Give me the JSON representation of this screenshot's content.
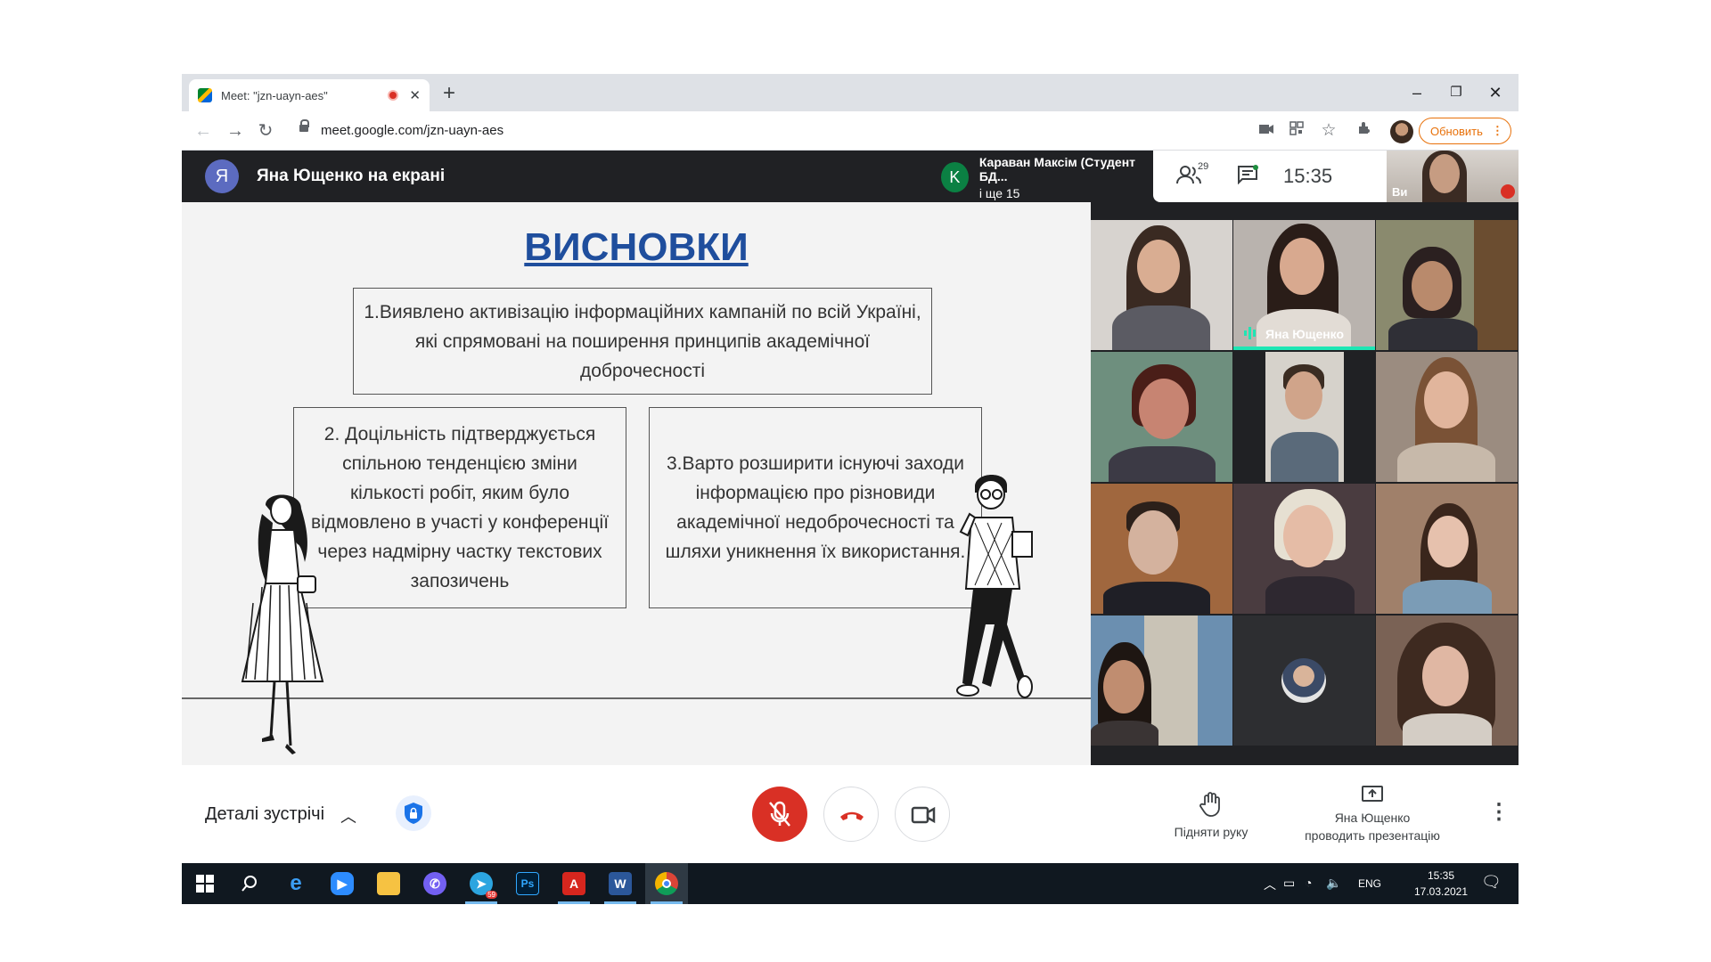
{
  "browser": {
    "tab_title": "Meet: \"jzn-uayn-aes\"",
    "tab_close": "✕",
    "new_tab": "+",
    "url": "meet.google.com/jzn-uayn-aes",
    "update_label": "Обновить",
    "minimize": "–",
    "restore": "❐",
    "close": "✕"
  },
  "meet": {
    "presenter_initial": "Я",
    "presenter_label": "Яна Ющенко на екрані",
    "speaker_initial": "K",
    "speaker_name": "Караван Максім (Студент БД...",
    "speaker_more": "і ще 15",
    "people_count": "29",
    "clock": "15:35",
    "self_label": "Ви"
  },
  "slide": {
    "title": "ВИСНОВКИ",
    "box1": "1.Виявлено активізацію інформаційних кампаній по всій Україні, які спрямовані на поширення принципів академічної доброчесності",
    "box2": "2. Доцільність підтверджується спільною тенденцією зміни кількості робіт, яким було відмовлено в участі у конференції через надмірну частку текстових запозичень",
    "box3": "3.Варто розширити існуючі заходи інформацією про різновиди академічної недоброчесності та шляхи уникнення їх використання."
  },
  "grid": {
    "active_speaker_label": "Яна Ющенко"
  },
  "controls": {
    "details_label": "Деталі зустрічі",
    "raise_hand_label": "Підняти руку",
    "presenting_line1": "Яна Ющенко",
    "presenting_line2": "проводить презентацію"
  },
  "taskbar": {
    "language": "ENG",
    "time": "15:35",
    "date": "17.03.2021",
    "telegram_badge": "59"
  },
  "colors": {
    "meet_dark": "#202124",
    "mic_off_red": "#d93025",
    "slide_title_blue": "#1f4e9d",
    "update_orange": "#e8710a",
    "speaking_teal": "#1ee6b4"
  }
}
